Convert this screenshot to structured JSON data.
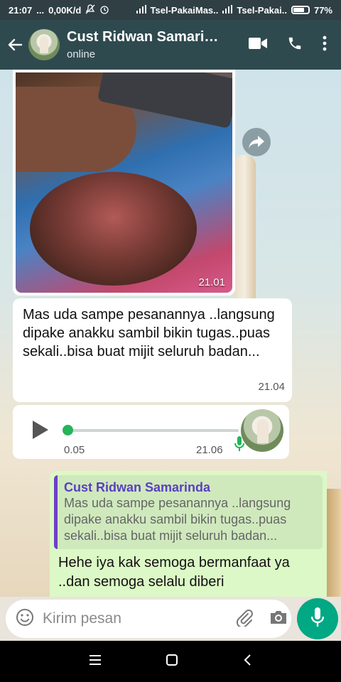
{
  "status_bar": {
    "time": "21:07",
    "dots": "...",
    "speed": "0,00K/d",
    "carrier1": "Tsel-PakaiMas..",
    "carrier2": "Tsel-Pakai..",
    "battery_text": "77%",
    "battery_level": 0.77
  },
  "header": {
    "contact_name": "Cust Ridwan Samarinda",
    "status": "online",
    "icons": [
      "back-arrow-icon",
      "avatar",
      "video-call-icon",
      "phone-icon",
      "more-vert-icon"
    ]
  },
  "messages": [
    {
      "type": "image",
      "direction": "in",
      "timestamp": "21.01"
    },
    {
      "type": "text",
      "direction": "in",
      "text": "Mas uda sampe pesanannya ..langsung dipake anakku sambil bikin tugas..puas sekali..bisa buat mijit seluruh badan...",
      "timestamp": "21.04"
    },
    {
      "type": "voice",
      "direction": "in",
      "duration": "0.05",
      "timestamp": "21.06",
      "progress": 0.0
    },
    {
      "type": "reply",
      "direction": "out",
      "quoted_author": "Cust Ridwan Samarinda",
      "quoted_text": "Mas uda sampe pesanannya ..langsung dipake anakku sambil bikin tugas..puas sekali..bisa buat mijit seluruh badan...",
      "text": "Hehe iya kak semoga bermanfaat ya ..dan semoga selalu diberi"
    }
  ],
  "input": {
    "placeholder": "Kirim pesan",
    "value": ""
  },
  "colors": {
    "header_bg": "#2f4a4f",
    "accent_green": "#00a884",
    "outgoing_bubble": "#dcf8c6",
    "quote_bar": "#6f3fc7"
  }
}
